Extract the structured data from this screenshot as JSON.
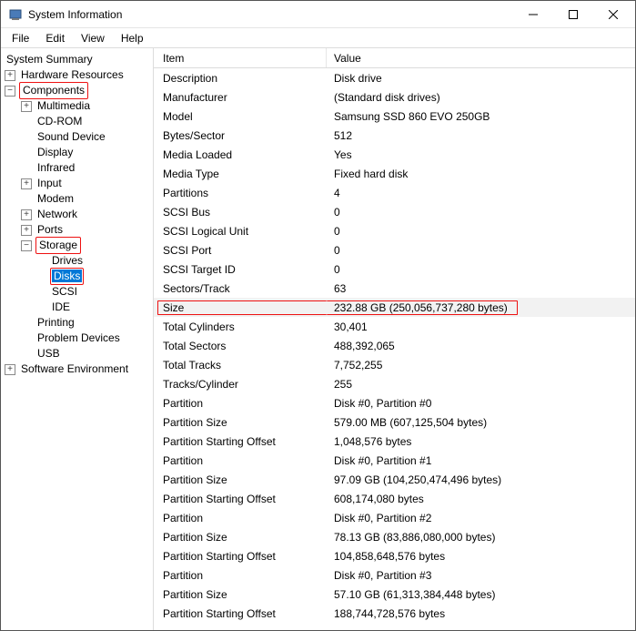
{
  "window": {
    "title": "System Information"
  },
  "menu": {
    "file": "File",
    "edit": "Edit",
    "view": "View",
    "help": "Help"
  },
  "tree": {
    "summary": "System Summary",
    "hw": "Hardware Resources",
    "components": "Components",
    "multimedia": "Multimedia",
    "cdrom": "CD-ROM",
    "sound": "Sound Device",
    "display": "Display",
    "infrared": "Infrared",
    "input": "Input",
    "modem": "Modem",
    "network": "Network",
    "ports": "Ports",
    "storage": "Storage",
    "drives": "Drives",
    "disks": "Disks",
    "scsi": "SCSI",
    "ide": "IDE",
    "printing": "Printing",
    "problem": "Problem Devices",
    "usb": "USB",
    "swenv": "Software Environment"
  },
  "cols": {
    "item": "Item",
    "value": "Value"
  },
  "rows": [
    {
      "i": "Description",
      "v": "Disk drive"
    },
    {
      "i": "Manufacturer",
      "v": "(Standard disk drives)"
    },
    {
      "i": "Model",
      "v": "Samsung SSD 860 EVO 250GB"
    },
    {
      "i": "Bytes/Sector",
      "v": "512"
    },
    {
      "i": "Media Loaded",
      "v": "Yes"
    },
    {
      "i": "Media Type",
      "v": "Fixed hard disk"
    },
    {
      "i": "Partitions",
      "v": "4"
    },
    {
      "i": "SCSI Bus",
      "v": "0"
    },
    {
      "i": "SCSI Logical Unit",
      "v": "0"
    },
    {
      "i": "SCSI Port",
      "v": "0"
    },
    {
      "i": "SCSI Target ID",
      "v": "0"
    },
    {
      "i": "Sectors/Track",
      "v": "63"
    },
    {
      "i": "Size",
      "v": "232.88 GB (250,056,737,280 bytes)"
    },
    {
      "i": "Total Cylinders",
      "v": "30,401"
    },
    {
      "i": "Total Sectors",
      "v": "488,392,065"
    },
    {
      "i": "Total Tracks",
      "v": "7,752,255"
    },
    {
      "i": "Tracks/Cylinder",
      "v": "255"
    },
    {
      "i": "Partition",
      "v": "Disk #0, Partition #0"
    },
    {
      "i": "Partition Size",
      "v": "579.00 MB (607,125,504 bytes)"
    },
    {
      "i": "Partition Starting Offset",
      "v": "1,048,576 bytes"
    },
    {
      "i": "Partition",
      "v": "Disk #0, Partition #1"
    },
    {
      "i": "Partition Size",
      "v": "97.09 GB (104,250,474,496 bytes)"
    },
    {
      "i": "Partition Starting Offset",
      "v": "608,174,080 bytes"
    },
    {
      "i": "Partition",
      "v": "Disk #0, Partition #2"
    },
    {
      "i": "Partition Size",
      "v": "78.13 GB (83,886,080,000 bytes)"
    },
    {
      "i": "Partition Starting Offset",
      "v": "104,858,648,576 bytes"
    },
    {
      "i": "Partition",
      "v": "Disk #0, Partition #3"
    },
    {
      "i": "Partition Size",
      "v": "57.10 GB (61,313,384,448 bytes)"
    },
    {
      "i": "Partition Starting Offset",
      "v": "188,744,728,576 bytes"
    }
  ]
}
